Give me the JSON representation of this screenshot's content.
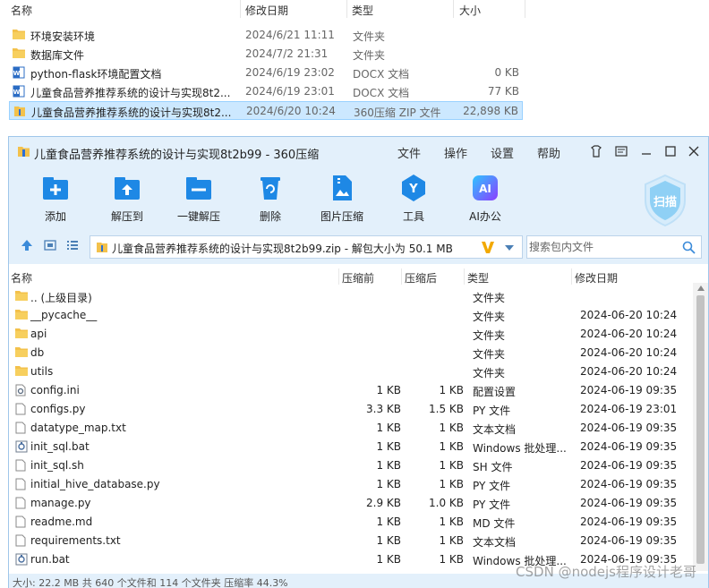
{
  "explorer": {
    "headers": {
      "name": "名称",
      "date": "修改日期",
      "type": "类型",
      "size": "大小"
    },
    "rows": [
      {
        "name": "环境安装环境",
        "date": "2024/6/21 11:11",
        "type": "文件夹",
        "size": "",
        "icon": "folder-icon"
      },
      {
        "name": "数据库文件",
        "date": "2024/7/2 21:31",
        "type": "文件夹",
        "size": "",
        "icon": "folder-icon"
      },
      {
        "name": "python-flask环境配置文档",
        "date": "2024/6/19 23:02",
        "type": "DOCX 文档",
        "size": "0 KB",
        "icon": "word-doc-icon"
      },
      {
        "name": "儿童食品营养推荐系统的设计与实现8t2...",
        "date": "2024/6/19 23:01",
        "type": "DOCX 文档",
        "size": "77 KB",
        "icon": "word-doc-icon"
      },
      {
        "name": "儿童食品营养推荐系统的设计与实现8t2...",
        "date": "2024/6/20 10:24",
        "type": "360压缩 ZIP 文件",
        "size": "22,898 KB",
        "icon": "zip-archive-icon"
      }
    ]
  },
  "zip": {
    "title": "儿童食品营养推荐系统的设计与实现8t2b99 - 360压缩",
    "menu": {
      "file": "文件",
      "operate": "操作",
      "settings": "设置",
      "help": "帮助"
    },
    "toolbar": {
      "add": "添加",
      "extract_to": "解压到",
      "one_click": "一键解压",
      "delete": "删除",
      "image_compress": "图片压缩",
      "tools": "工具",
      "ai_office": "AI办公",
      "scan": "扫描",
      "ai_badge": "AI",
      "tools_badge": "Y"
    },
    "address": "儿童食品营养推荐系统的设计与实现8t2b99.zip - 解包大小为 50.1 MB",
    "search_placeholder": "搜索包内文件",
    "columns": {
      "name": "名称",
      "compressed": "压缩前",
      "size": "压缩后",
      "type": "类型",
      "date": "修改日期"
    },
    "files": [
      {
        "name": ".. (上级目录)",
        "compressed": "",
        "size": "",
        "type": "文件夹",
        "date": "",
        "icon": "folder-icon"
      },
      {
        "name": "__pycache__",
        "compressed": "",
        "size": "",
        "type": "文件夹",
        "date": "2024-06-20 10:24",
        "icon": "folder-icon"
      },
      {
        "name": "api",
        "compressed": "",
        "size": "",
        "type": "文件夹",
        "date": "2024-06-20 10:24",
        "icon": "folder-icon"
      },
      {
        "name": "db",
        "compressed": "",
        "size": "",
        "type": "文件夹",
        "date": "2024-06-20 10:24",
        "icon": "folder-icon"
      },
      {
        "name": "utils",
        "compressed": "",
        "size": "",
        "type": "文件夹",
        "date": "2024-06-20 10:24",
        "icon": "folder-icon"
      },
      {
        "name": "config.ini",
        "compressed": "1 KB",
        "size": "1 KB",
        "type": "配置设置",
        "date": "2024-06-19 09:35",
        "icon": "config-file-icon"
      },
      {
        "name": "configs.py",
        "compressed": "3.3 KB",
        "size": "1.5 KB",
        "type": "PY 文件",
        "date": "2024-06-19 23:01",
        "icon": "file-icon"
      },
      {
        "name": "datatype_map.txt",
        "compressed": "1 KB",
        "size": "1 KB",
        "type": "文本文档",
        "date": "2024-06-19 09:35",
        "icon": "file-icon"
      },
      {
        "name": "init_sql.bat",
        "compressed": "1 KB",
        "size": "1 KB",
        "type": "Windows 批处理...",
        "date": "2024-06-19 09:35",
        "icon": "bat-file-icon"
      },
      {
        "name": "init_sql.sh",
        "compressed": "1 KB",
        "size": "1 KB",
        "type": "SH 文件",
        "date": "2024-06-19 09:35",
        "icon": "file-icon"
      },
      {
        "name": "initial_hive_database.py",
        "compressed": "1 KB",
        "size": "1 KB",
        "type": "PY 文件",
        "date": "2024-06-19 09:35",
        "icon": "file-icon"
      },
      {
        "name": "manage.py",
        "compressed": "2.9 KB",
        "size": "1.0 KB",
        "type": "PY 文件",
        "date": "2024-06-19 09:35",
        "icon": "file-icon"
      },
      {
        "name": "readme.md",
        "compressed": "1 KB",
        "size": "1 KB",
        "type": "MD 文件",
        "date": "2024-06-19 09:35",
        "icon": "file-icon"
      },
      {
        "name": "requirements.txt",
        "compressed": "1 KB",
        "size": "1 KB",
        "type": "文本文档",
        "date": "2024-06-19 09:35",
        "icon": "file-icon"
      },
      {
        "name": "run.bat",
        "compressed": "1 KB",
        "size": "1 KB",
        "type": "Windows 批处理...",
        "date": "2024-06-19 09:35",
        "icon": "bat-file-icon"
      }
    ],
    "status": "大小: 22.2 MB 共 640 个文件和 114 个文件夹 压缩率 44.3%"
  },
  "watermark": "CSDN @nodejs程序设计老哥",
  "colors": {
    "accent": "#1e88e5",
    "chrome": "#e3f0fb",
    "selection": "#cce8ff",
    "folder": "#f3c14b",
    "ai": "#7b4dff"
  }
}
